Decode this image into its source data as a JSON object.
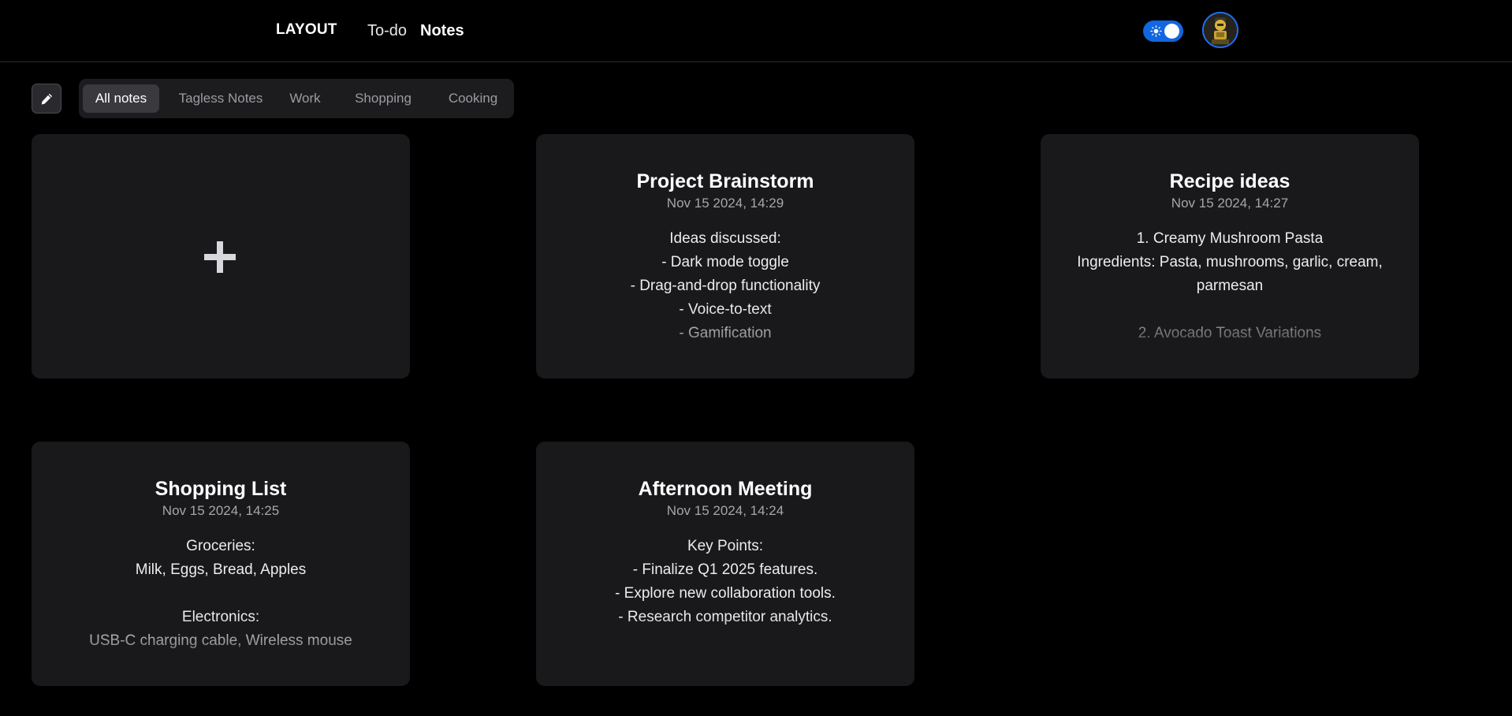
{
  "header": {
    "logo": "LAYOUT",
    "nav": [
      {
        "label": "To-do",
        "active": false
      },
      {
        "label": "Notes",
        "active": true
      }
    ],
    "theme_toggle": {
      "icon": "sun-icon",
      "state": "on",
      "color": "#1266e0"
    },
    "avatar": {
      "icon": "avatar-image"
    }
  },
  "toolbar": {
    "edit_icon": "pencil-icon",
    "tags": [
      {
        "label": "All notes",
        "active": true
      },
      {
        "label": "Tagless Notes",
        "active": false
      },
      {
        "label": "Work",
        "active": false
      },
      {
        "label": "Shopping",
        "active": false
      },
      {
        "label": "Cooking",
        "active": false
      }
    ]
  },
  "add_card": {
    "icon": "plus-icon"
  },
  "notes": [
    {
      "title": "Project Brainstorm",
      "date": "Nov 15 2024, 14:29",
      "lines": [
        "Ideas discussed:",
        "- Dark mode toggle",
        "- Drag-and-drop functionality",
        "- Voice-to-text",
        "- Gamification"
      ]
    },
    {
      "title": "Recipe ideas",
      "date": "Nov 15 2024, 14:27",
      "lines": [
        "1. Creamy Mushroom Pasta",
        "Ingredients: Pasta, mushrooms, garlic, cream, parmesan",
        "",
        "2. Avocado Toast Variations"
      ]
    },
    {
      "title": "Shopping List",
      "date": "Nov 15 2024, 14:25",
      "lines": [
        "Groceries:",
        "Milk, Eggs, Bread, Apples",
        "",
        "Electronics:",
        "USB-C charging cable, Wireless mouse"
      ]
    },
    {
      "title": "Afternoon Meeting",
      "date": "Nov 15 2024, 14:24",
      "lines": [
        "Key Points:",
        "- Finalize Q1 2025 features.",
        "- Explore new collaboration tools.",
        "- Research competitor analytics."
      ]
    }
  ]
}
